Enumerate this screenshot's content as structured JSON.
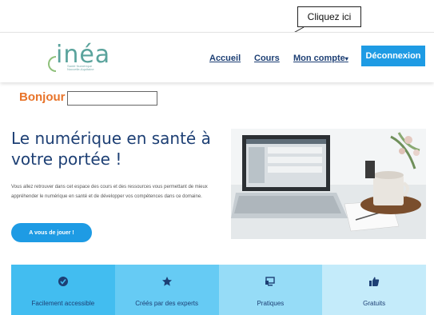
{
  "annotation": {
    "callout": "Cliquez ici"
  },
  "header": {
    "logo": {
      "name": "inéa",
      "tagline": "Santé Numérique Nouvelle-Aquitaine"
    },
    "nav": [
      "Accueil",
      "Cours",
      "Mon compte"
    ],
    "logout_label": "Déconnexion",
    "brand_color": "#1e9be4"
  },
  "greeting": {
    "label": "Bonjour",
    "value": ""
  },
  "hero": {
    "title": "Le numérique en santé à votre portée !",
    "description": "Vous allez retrouver dans cet espace des cours et des ressources vous permettant de mieux appréhender le numérique en santé et de développer vos compétences dans ce domaine.",
    "cta_label": "A vous de jouer !"
  },
  "features": [
    {
      "label": "Facilement accessible",
      "icon": "check-circle-icon",
      "bg": "#42bdf0"
    },
    {
      "label": "Créés par des experts",
      "icon": "star-icon",
      "bg": "#66cbf4"
    },
    {
      "label": "Pratiques",
      "icon": "screen-icon",
      "bg": "#96dcf7"
    },
    {
      "label": "Gratuits",
      "icon": "thumbs-up-icon",
      "bg": "#c4ebfa"
    }
  ]
}
